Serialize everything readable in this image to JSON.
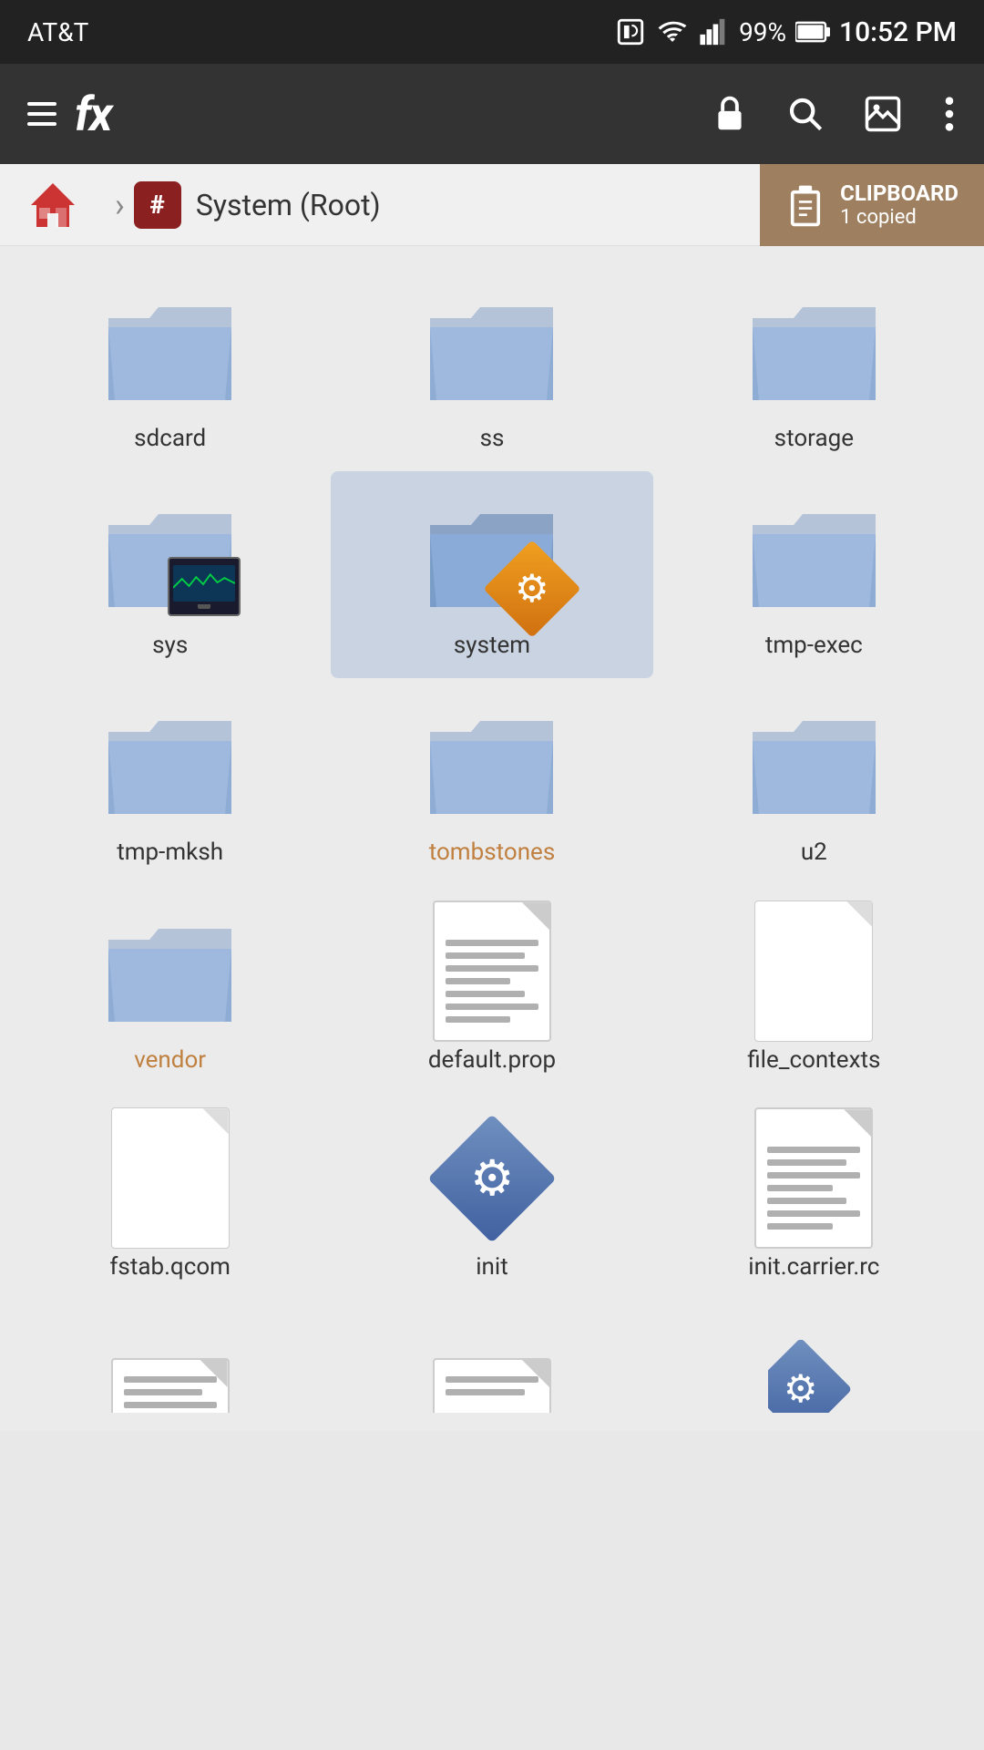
{
  "statusBar": {
    "carrier": "AT&T",
    "battery": "99%",
    "time": "10:52 PM"
  },
  "toolbar": {
    "logoText": "fx",
    "actions": [
      "lock",
      "search",
      "image",
      "more"
    ]
  },
  "breadcrumb": {
    "rootBadge": "#",
    "title": "System (Root)",
    "clipboard": {
      "label": "CLIPBOARD",
      "count": "1 copied"
    }
  },
  "files": [
    {
      "name": "sdcard",
      "type": "folder",
      "highlight": false
    },
    {
      "name": "ss",
      "type": "folder",
      "highlight": false
    },
    {
      "name": "storage",
      "type": "folder",
      "highlight": false
    },
    {
      "name": "sys",
      "type": "folder-monitor",
      "highlight": false
    },
    {
      "name": "system",
      "type": "folder-gear-orange",
      "highlight": false,
      "selected": true
    },
    {
      "name": "tmp-exec",
      "type": "folder",
      "highlight": false
    },
    {
      "name": "tmp-mksh",
      "type": "folder",
      "highlight": false
    },
    {
      "name": "tombstones",
      "type": "folder",
      "highlight": true
    },
    {
      "name": "u2",
      "type": "folder",
      "highlight": false
    },
    {
      "name": "vendor",
      "type": "folder",
      "highlight": true
    },
    {
      "name": "default.prop",
      "type": "document",
      "highlight": false
    },
    {
      "name": "file_contexts",
      "type": "blank",
      "highlight": false
    },
    {
      "name": "fstab.qcom",
      "type": "blank",
      "highlight": false
    },
    {
      "name": "init",
      "type": "gear-diamond-blue",
      "highlight": false
    },
    {
      "name": "init.carrier.rc",
      "type": "document",
      "highlight": false
    }
  ],
  "partialFiles": [
    {
      "name": "",
      "type": "document-partial",
      "highlight": false
    },
    {
      "name": "",
      "type": "document-partial",
      "highlight": false
    },
    {
      "name": "",
      "type": "gear-diamond-blue-partial",
      "highlight": false
    }
  ]
}
